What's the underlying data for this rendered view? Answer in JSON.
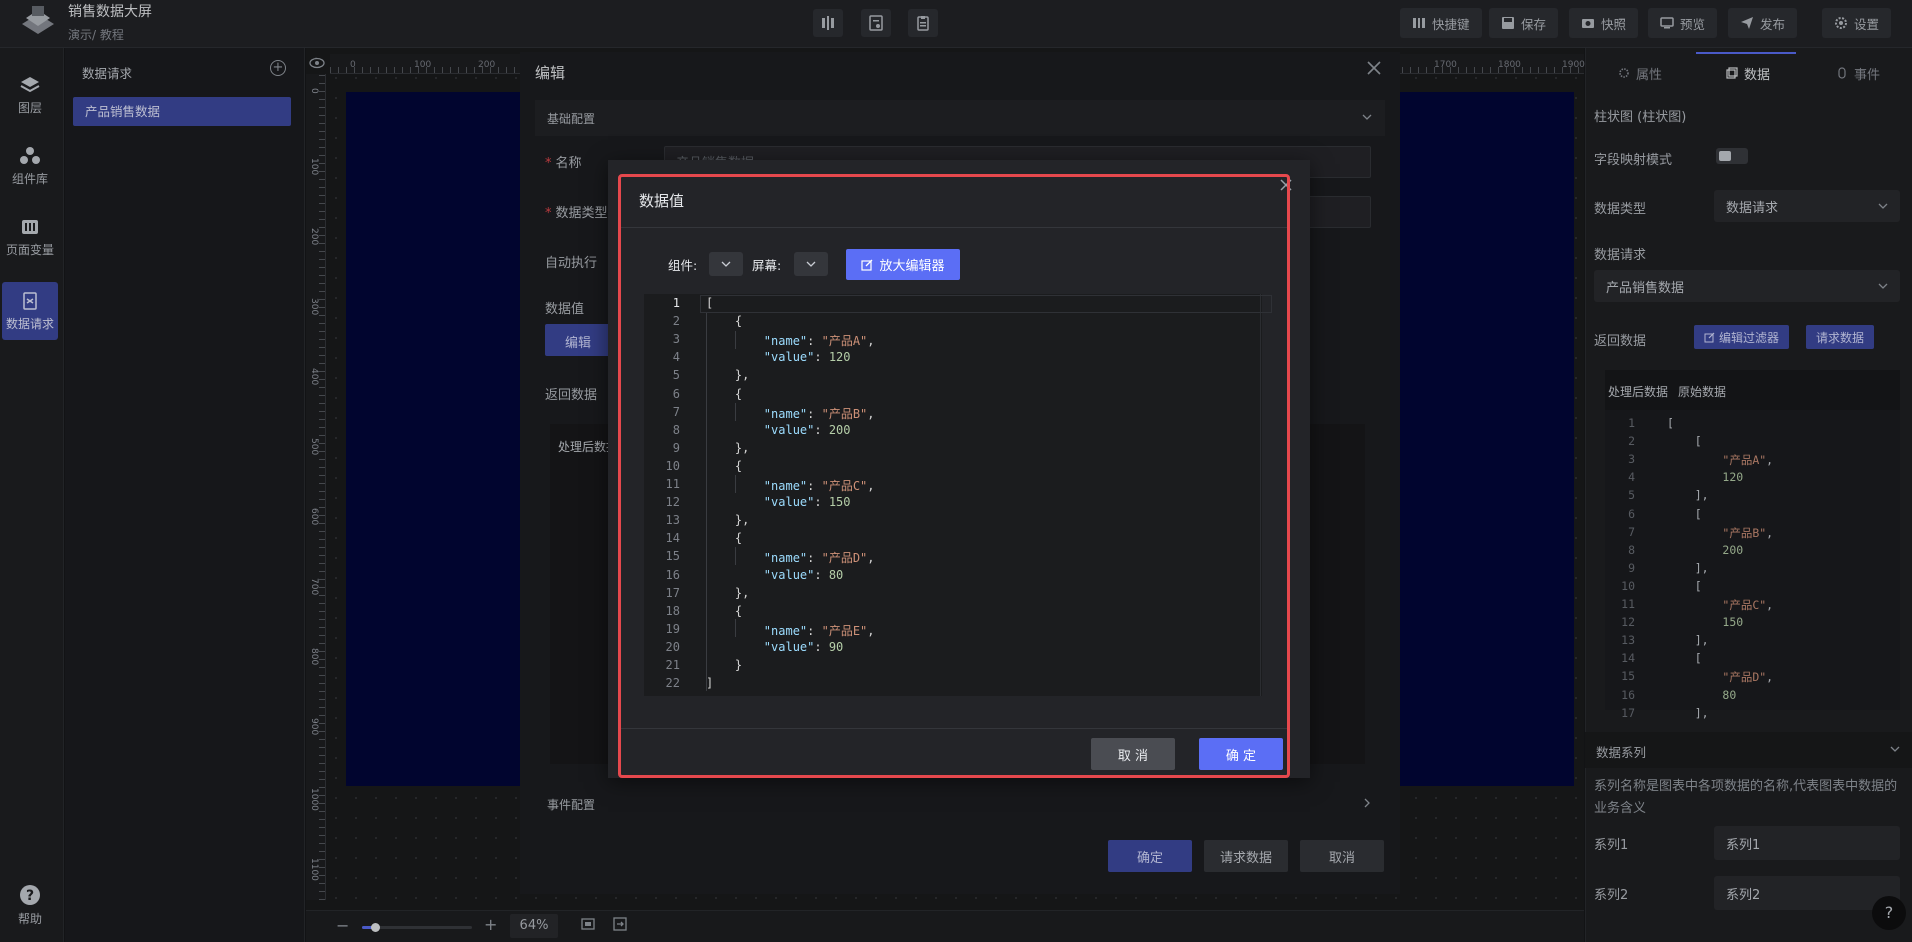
{
  "app": {
    "title": "销售数据大屏",
    "breadcrumb": "演示/ 教程"
  },
  "toolbar": {
    "shortcut_label": "快捷键",
    "save_label": "保存",
    "snapshot_label": "快照",
    "preview_label": "预览",
    "publish_label": "发布",
    "settings_label": "设置"
  },
  "rail": {
    "items": [
      {
        "label": "图层",
        "icon": "layers-icon"
      },
      {
        "label": "组件库",
        "icon": "components-icon"
      },
      {
        "label": "页面变量",
        "icon": "variables-icon"
      },
      {
        "label": "数据请求",
        "icon": "data-request-icon"
      }
    ],
    "active_index": 3,
    "help_label": "帮助"
  },
  "data_panel": {
    "title": "数据请求",
    "items": [
      "产品销售数据"
    ]
  },
  "ruler": {
    "top_ticks": [
      "0",
      "100",
      "200",
      "1700",
      "1800",
      "1900"
    ],
    "left_ticks": [
      "0",
      "100",
      "200",
      "300",
      "400",
      "500",
      "600",
      "700",
      "800",
      "900",
      "1000",
      "1100"
    ]
  },
  "editor": {
    "title": "编辑",
    "basic_config_label": "基础配置",
    "name_label": "名称",
    "name_value": "产品销售数据",
    "type_label": "数据类型",
    "auto_exec_label": "自动执行",
    "data_value_label": "数据值",
    "edit_button_label": "编辑",
    "return_data_label": "返回数据",
    "processed_tab_label": "处理后数据",
    "event_config_label": "事件配置",
    "confirm_label": "确定",
    "request_data_label": "请求数据",
    "cancel_label": "取消"
  },
  "modal": {
    "title": "数据值",
    "component_label": "组件:",
    "screen_label": "屏幕:",
    "enlarge_label": "放大编辑器",
    "cancel_label": "取 消",
    "ok_label": "确 定",
    "code_lines": [
      "[",
      "    {",
      "        \"name\": \"产品A\",",
      "        \"value\": 120",
      "    },",
      "    {",
      "        \"name\": \"产品B\",",
      "        \"value\": 200",
      "    },",
      "    {",
      "        \"name\": \"产品C\",",
      "        \"value\": 150",
      "    },",
      "    {",
      "        \"name\": \"产品D\",",
      "        \"value\": 80",
      "    },",
      "    {",
      "        \"name\": \"产品E\",",
      "        \"value\": 90",
      "    }",
      "]"
    ]
  },
  "right_panel": {
    "tabs": [
      "属性",
      "数据",
      "事件"
    ],
    "active_tab": 1,
    "component_name": "柱状图 (柱状图)",
    "field_mapping_label": "字段映射模式",
    "data_type_label": "数据类型",
    "data_type_value": "数据请求",
    "data_request_label": "数据请求",
    "data_request_value": "产品销售数据",
    "return_data_label": "返回数据",
    "edit_filter_label": "编辑过滤器",
    "request_data_label": "请求数据",
    "processed_tab": "处理后数据",
    "raw_tab": "原始数据",
    "code_lines": [
      "[",
      "    [",
      "        \"产品A\",",
      "        120",
      "    ],",
      "    [",
      "        \"产品B\",",
      "        200",
      "    ],",
      "    [",
      "        \"产品C\",",
      "        150",
      "    ],",
      "    [",
      "        \"产品D\",",
      "        80",
      "    ],"
    ],
    "series_header": "数据系列",
    "series_desc": "系列名称是图表中各项数据的名称,代表图表中数据的业务含义",
    "series": [
      {
        "label": "系列1",
        "value": "系列1"
      },
      {
        "label": "系列2",
        "value": "系列2"
      }
    ]
  },
  "zoom": {
    "value": "64%"
  }
}
